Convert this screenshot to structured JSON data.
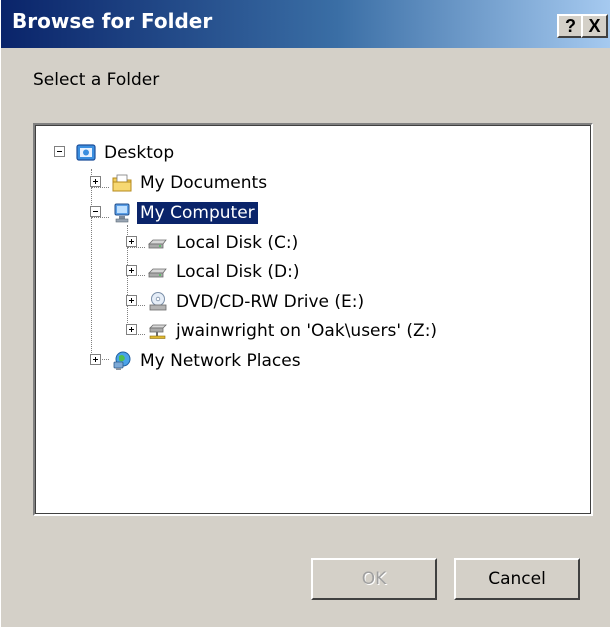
{
  "window": {
    "title": "Browse for Folder",
    "help_glyph": "?",
    "close_glyph": "X"
  },
  "prompt": "Select a Folder",
  "tree": {
    "root": {
      "label": "Desktop",
      "icon": "desktop-icon",
      "expanded": true
    },
    "items": [
      {
        "label": "My Documents",
        "icon": "folder-documents-icon",
        "expanded": false
      },
      {
        "label": "My Computer",
        "icon": "computer-icon",
        "expanded": true,
        "selected": true
      },
      {
        "label": "Local Disk (C:)",
        "icon": "hard-disk-icon",
        "expanded": false
      },
      {
        "label": "Local Disk (D:)",
        "icon": "hard-disk-icon",
        "expanded": false
      },
      {
        "label": "DVD/CD-RW Drive (E:)",
        "icon": "optical-drive-icon",
        "expanded": false
      },
      {
        "label": "jwainwright on 'Oak\\users' (Z:)",
        "icon": "network-drive-icon",
        "expanded": false
      },
      {
        "label": "My Network Places",
        "icon": "network-places-icon",
        "expanded": false
      }
    ]
  },
  "buttons": {
    "ok": "OK",
    "cancel": "Cancel"
  },
  "colors": {
    "titlebar_start": "#0a246a",
    "titlebar_end": "#a6caf0",
    "selection": "#0a246a",
    "dialog_face": "#d4d0c8"
  }
}
